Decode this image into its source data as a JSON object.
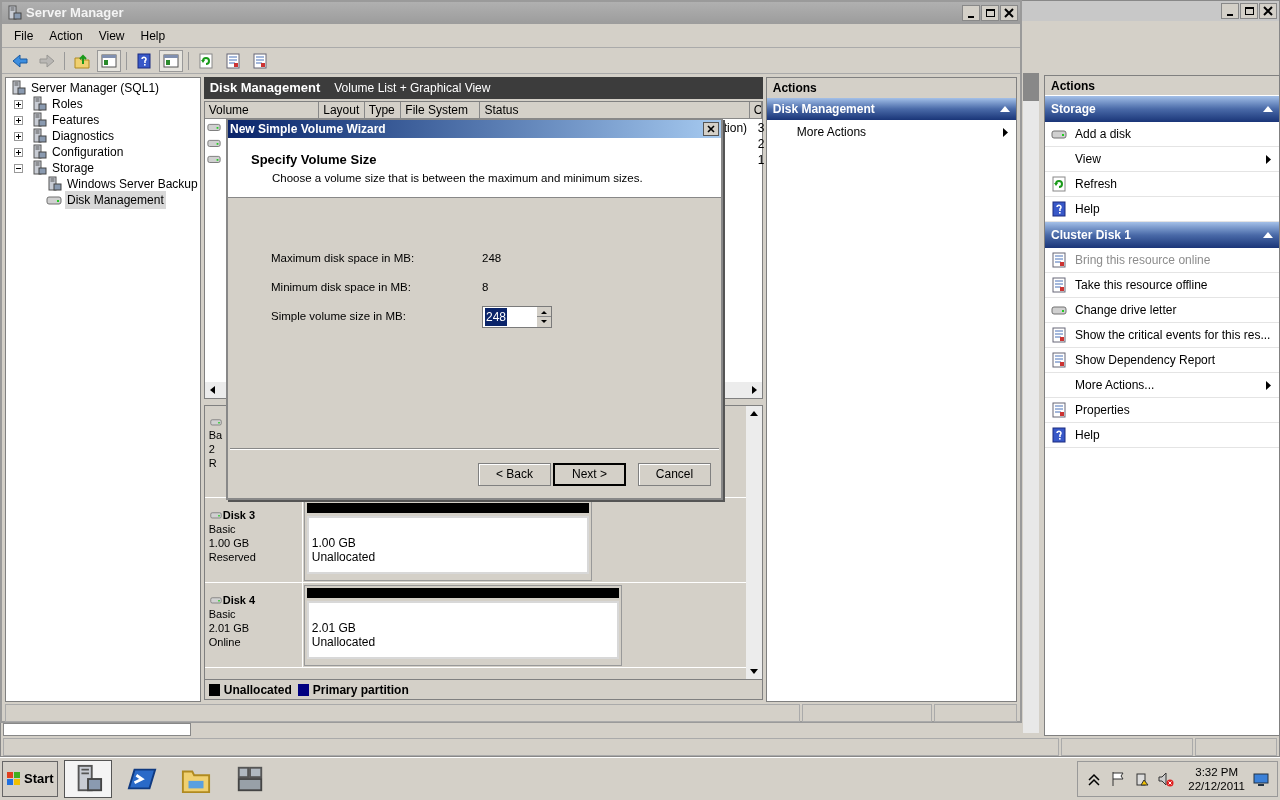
{
  "background_window": {
    "actions": {
      "title": "Actions",
      "sections": [
        {
          "title": "Storage",
          "expanded": true,
          "items": [
            {
              "label": "Add a disk",
              "kind": "disk",
              "disabled": false
            },
            {
              "label": "View",
              "kind": "submenu",
              "disabled": false
            },
            {
              "label": "Refresh",
              "kind": "refresh",
              "disabled": false
            },
            {
              "label": "Help",
              "kind": "help",
              "disabled": false
            }
          ]
        },
        {
          "title": "Cluster Disk 1",
          "expanded": true,
          "items": [
            {
              "label": "Bring this resource online",
              "kind": "report",
              "disabled": true
            },
            {
              "label": "Take this resource offline",
              "kind": "report",
              "disabled": false
            },
            {
              "label": "Change drive letter",
              "kind": "disk",
              "disabled": false
            },
            {
              "label": "Show the critical events for this res...",
              "kind": "report",
              "disabled": false
            },
            {
              "label": "Show Dependency Report",
              "kind": "report",
              "disabled": false
            },
            {
              "label": "More Actions...",
              "kind": "submenu",
              "disabled": false
            },
            {
              "label": "Properties",
              "kind": "report",
              "disabled": false
            },
            {
              "label": "Help",
              "kind": "help",
              "disabled": false
            }
          ]
        }
      ]
    }
  },
  "window": {
    "title": "Server Manager",
    "menu": [
      "File",
      "Action",
      "View",
      "Help"
    ],
    "toolbar": [
      {
        "kind": "back",
        "disabled": false,
        "pressed": false
      },
      {
        "kind": "forward",
        "disabled": true,
        "pressed": false
      },
      {
        "kind": "up",
        "disabled": false,
        "pressed": false
      },
      {
        "kind": "panel",
        "disabled": false,
        "pressed": true
      },
      {
        "kind": "help",
        "disabled": false,
        "pressed": false
      },
      {
        "kind": "panel",
        "disabled": false,
        "pressed": true
      },
      {
        "kind": "refresh",
        "disabled": false,
        "pressed": false
      },
      {
        "kind": "report",
        "disabled": false,
        "pressed": false
      },
      {
        "kind": "report",
        "disabled": false,
        "pressed": false
      }
    ],
    "tree": [
      {
        "label": "Server Manager (SQL1)",
        "kind": "server",
        "selected": false,
        "children": [
          {
            "label": "Roles",
            "kind": "server",
            "expanded": false,
            "selected": false
          },
          {
            "label": "Features",
            "kind": "server",
            "expanded": false,
            "selected": false
          },
          {
            "label": "Diagnostics",
            "kind": "server",
            "expanded": false,
            "selected": false
          },
          {
            "label": "Configuration",
            "kind": "server",
            "expanded": false,
            "selected": false
          },
          {
            "label": "Storage",
            "kind": "server",
            "expanded": true,
            "selected": false,
            "children": [
              {
                "label": "Windows Server Backup",
                "kind": "server",
                "selected": false
              },
              {
                "label": "Disk Management",
                "kind": "disk",
                "selected": true
              }
            ]
          }
        ]
      }
    ],
    "center": {
      "title": "Disk Management",
      "view": "Volume List + Graphical View",
      "columns": [
        "Volume",
        "Layout",
        "Type",
        "File System",
        "Status",
        "C"
      ],
      "volumes": [
        {
          "status": "tion)",
          "column_6": "3"
        },
        {
          "column_6": "2"
        },
        {
          "column_6": "1"
        }
      ],
      "disks": [
        {
          "type": "Ba",
          "size": "2",
          "state": "R"
        },
        {
          "name": "Disk 3",
          "type": "Basic",
          "size": "1.00 GB",
          "state": "Reserved",
          "partitions": [
            {
              "size": "1.00 GB",
              "label": "Unallocated",
              "kind": "unallocated"
            }
          ]
        },
        {
          "name": "Disk 4",
          "type": "Basic",
          "size": "2.01 GB",
          "state": "Online",
          "partitions": [
            {
              "size": "2.01 GB",
              "label": "Unallocated",
              "kind": "unallocated"
            }
          ]
        }
      ],
      "legend": [
        {
          "label": "Unallocated",
          "color": "#000000"
        },
        {
          "label": "Primary partition",
          "color": "#000080"
        }
      ]
    },
    "actions": {
      "title": "Actions",
      "sections": [
        {
          "title": "Disk Management",
          "expanded": true,
          "items": [
            {
              "label": "More Actions",
              "kind": "submenu",
              "disabled": false
            }
          ]
        }
      ]
    }
  },
  "wizard": {
    "title": "New Simple Volume Wizard",
    "heading": "Specify Volume Size",
    "subtitle": "Choose a volume size that is between the maximum and minimum sizes.",
    "fields": [
      {
        "label": "Maximum disk space in MB:",
        "value": "248",
        "kind": "text"
      },
      {
        "label": "Minimum disk space in MB:",
        "value": "8",
        "kind": "text"
      },
      {
        "label": "Simple volume size in MB:",
        "value": "248",
        "kind": "spinner"
      }
    ],
    "buttons": [
      {
        "label": "< Back",
        "default": false
      },
      {
        "label": "Next >",
        "default": true
      },
      {
        "label": "Cancel",
        "default": false
      }
    ]
  },
  "taskbar": {
    "start": "Start",
    "apps": [
      {
        "kind": "server",
        "selected": true
      },
      {
        "kind": "terminal",
        "selected": false
      },
      {
        "kind": "folder",
        "selected": false
      },
      {
        "kind": "rack",
        "selected": false
      }
    ],
    "time": "3:32 PM",
    "date": "22/12/2011"
  }
}
